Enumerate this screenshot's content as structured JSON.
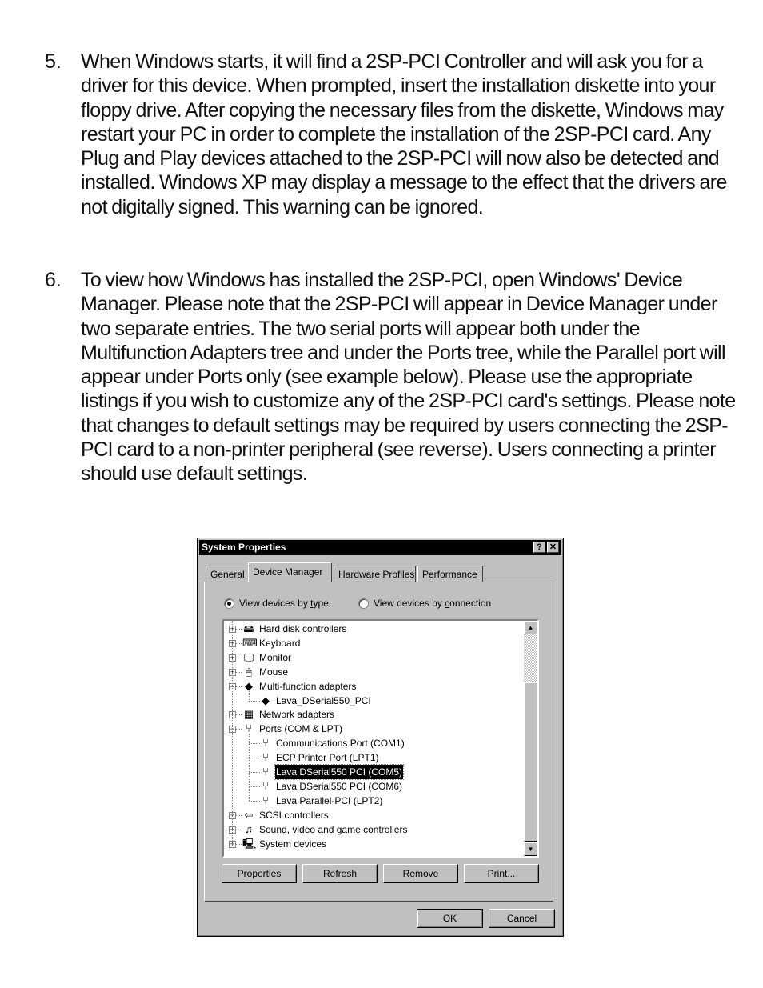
{
  "steps": [
    {
      "number": "5.",
      "text": "When Windows starts, it will find a 2SP-PCI Controller and will ask you for a driver for this device. When prompted, insert the installation diskette into your floppy drive. After copying the necessary files from the diskette, Windows may restart your PC in order to complete the installation of the 2SP-PCI card. Any Plug and Play devices attached to the 2SP-PCI will now also be detected and installed. Windows XP may display a message to the effect that the drivers are not digitally signed. This warning can be ignored."
    },
    {
      "number": "6.",
      "text": "To view how Windows has installed the 2SP-PCI, open Windows' Device Manager. Please note that the 2SP-PCI will appear in Device Manager under two separate entries. The two serial ports will appear both under the Multifunction Adapters tree and under the Ports tree, while the Parallel port will appear under Ports only (see example below). Please use the appropriate listings if you wish to customize any of the 2SP-PCI card's settings. Please note that changes to default settings may be required by users connecting the 2SP-PCI card to a non-printer peripheral (see reverse). Users connecting a printer should use default settings."
    }
  ],
  "dialog": {
    "title": "System Properties",
    "help_icon": "?",
    "close_icon": "✕",
    "tabs": [
      {
        "label": "General",
        "active": false
      },
      {
        "label": "Device Manager",
        "active": true
      },
      {
        "label": "Hardware Profiles",
        "active": false
      },
      {
        "label": "Performance",
        "active": false
      }
    ],
    "view_options": [
      {
        "label_pre": "View devices by ",
        "label_ul": "t",
        "label_post": "ype",
        "selected": true
      },
      {
        "label_pre": "View devices by ",
        "label_ul": "c",
        "label_post": "onnection",
        "selected": false
      }
    ],
    "tree": [
      {
        "label": "Hard disk controllers",
        "level": 0,
        "expander": "+",
        "icon": "hard-disk-icon",
        "glyph": "🖴"
      },
      {
        "label": "Keyboard",
        "level": 0,
        "expander": "+",
        "icon": "keyboard-icon",
        "glyph": "⌨"
      },
      {
        "label": "Monitor",
        "level": 0,
        "expander": "+",
        "icon": "monitor-icon",
        "glyph": "🖵"
      },
      {
        "label": "Mouse",
        "level": 0,
        "expander": "+",
        "icon": "mouse-icon",
        "glyph": "🖱"
      },
      {
        "label": "Multi-function adapters",
        "level": 0,
        "expander": "−",
        "icon": "multifunction-adapter-icon",
        "glyph": "◆"
      },
      {
        "label": "Lava_DSerial550_PCI",
        "level": 1,
        "expander": "",
        "icon": "multifunction-adapter-icon",
        "glyph": "◆"
      },
      {
        "label": "Network adapters",
        "level": 0,
        "expander": "+",
        "icon": "network-adapter-icon",
        "glyph": "▦"
      },
      {
        "label": "Ports (COM & LPT)",
        "level": 0,
        "expander": "−",
        "icon": "port-icon",
        "glyph": "⑂"
      },
      {
        "label": "Communications Port (COM1)",
        "level": 1,
        "expander": "",
        "icon": "port-icon",
        "glyph": "⑂"
      },
      {
        "label": "ECP Printer Port (LPT1)",
        "level": 1,
        "expander": "",
        "icon": "port-icon",
        "glyph": "⑂"
      },
      {
        "label": "Lava DSerial550 PCI (COM5)",
        "level": 1,
        "expander": "",
        "icon": "port-icon",
        "glyph": "⑂",
        "selected": true
      },
      {
        "label": "Lava DSerial550 PCI (COM6)",
        "level": 1,
        "expander": "",
        "icon": "port-icon",
        "glyph": "⑂"
      },
      {
        "label": "Lava Parallel-PCI (LPT2)",
        "level": 1,
        "expander": "",
        "icon": "port-icon",
        "glyph": "⑂"
      },
      {
        "label": "SCSI controllers",
        "level": 0,
        "expander": "+",
        "icon": "scsi-controller-icon",
        "glyph": "⇦"
      },
      {
        "label": "Sound, video and game controllers",
        "level": 0,
        "expander": "+",
        "icon": "sound-video-icon",
        "glyph": "♫"
      },
      {
        "label": "System devices",
        "level": 0,
        "expander": "+",
        "icon": "system-devices-icon",
        "glyph": "🖳"
      }
    ],
    "scrollbar": {
      "up_arrow": "▲",
      "down_arrow": "▼",
      "position_fraction": 0.28,
      "visible_fraction": 0.73
    },
    "action_buttons": [
      {
        "pre": "P",
        "ul": "r",
        "post": "operties",
        "name": "properties-button"
      },
      {
        "pre": "Re",
        "ul": "f",
        "post": "resh",
        "name": "refresh-button"
      },
      {
        "pre": "R",
        "ul": "e",
        "post": "move",
        "name": "remove-button"
      },
      {
        "pre": "Pri",
        "ul": "n",
        "post": "t...",
        "name": "print-button"
      }
    ],
    "ok_label": "OK",
    "cancel_label": "Cancel"
  }
}
